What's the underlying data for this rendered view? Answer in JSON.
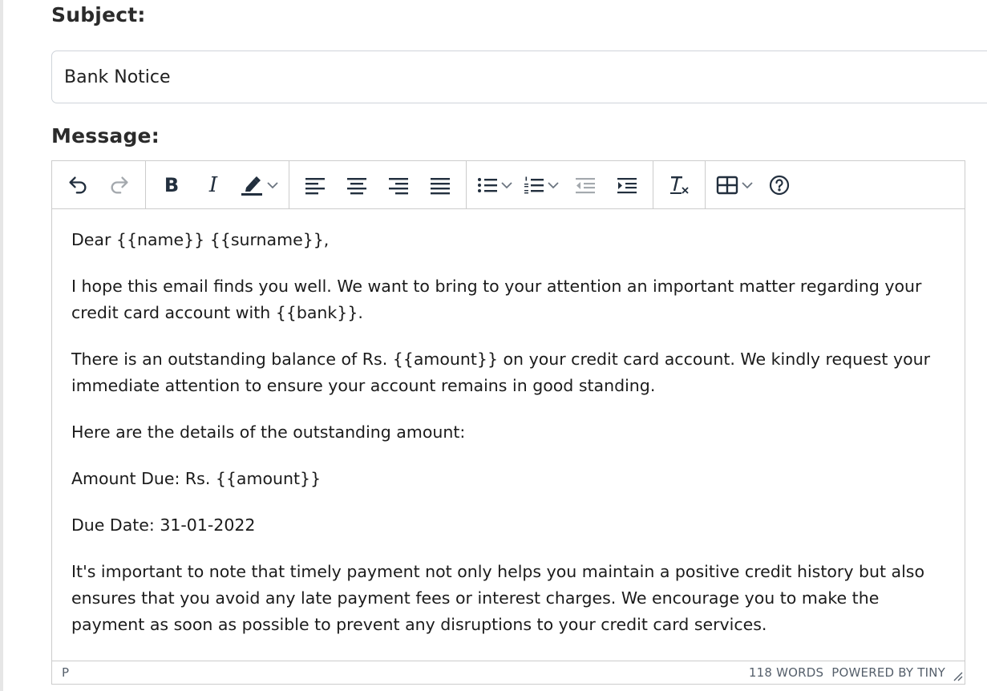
{
  "form": {
    "subject_label": "Subject:",
    "subject_value": "Bank Notice",
    "message_label": "Message:"
  },
  "toolbar": {
    "bold_glyph": "B",
    "italic_glyph": "I",
    "icons": [
      "undo-icon",
      "redo-icon",
      "bold-icon",
      "italic-icon",
      "highlight-icon",
      "align-left-icon",
      "align-center-icon",
      "align-right-icon",
      "align-justify-icon",
      "bullet-list-icon",
      "numbered-list-icon",
      "outdent-icon",
      "indent-icon",
      "clear-format-icon",
      "table-icon",
      "help-icon"
    ],
    "icon_color": "#222f3e",
    "disabled_color": "#a4a9ae"
  },
  "editor": {
    "paragraphs": [
      "Dear {{name}} {{surname}},",
      "I hope this email finds you well. We want to bring to your attention an important matter regarding your credit card account with {{bank}}.",
      "There is an outstanding balance of Rs. {{amount}} on your credit card account. We kindly request your immediate attention to ensure your account remains in good standing.",
      "Here are the details of the outstanding amount:",
      "Amount Due: Rs. {{amount}}",
      "Due Date: 31-01-2022",
      "It's important to note that timely payment not only helps you maintain a positive credit history but also ensures that you avoid any late payment fees or interest charges. We encourage you to make the payment as soon as possible to prevent any disruptions to your credit card services."
    ]
  },
  "statusbar": {
    "element_path": "P",
    "word_count": "118 WORDS",
    "brand": "POWERED BY TINY"
  }
}
